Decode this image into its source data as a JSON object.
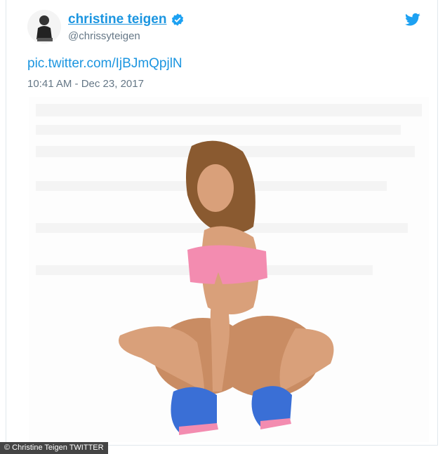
{
  "tweet": {
    "display_name": "christine teigen",
    "handle": "@chrissyteigen",
    "link_text": "pic.twitter.com/IjBJmQpjlN",
    "timestamp": "10:41 AM - Dec 23, 2017"
  },
  "icons": {
    "verified": "verified-badge-icon",
    "platform": "twitter-bird-icon"
  },
  "colors": {
    "link_blue": "#1b95e0",
    "muted_gray": "#657786",
    "outfit_pink": "#f38cb0",
    "shoe_blue": "#3a6fd6"
  },
  "caption": {
    "credit": "© Christine Teigen TWITTER"
  }
}
